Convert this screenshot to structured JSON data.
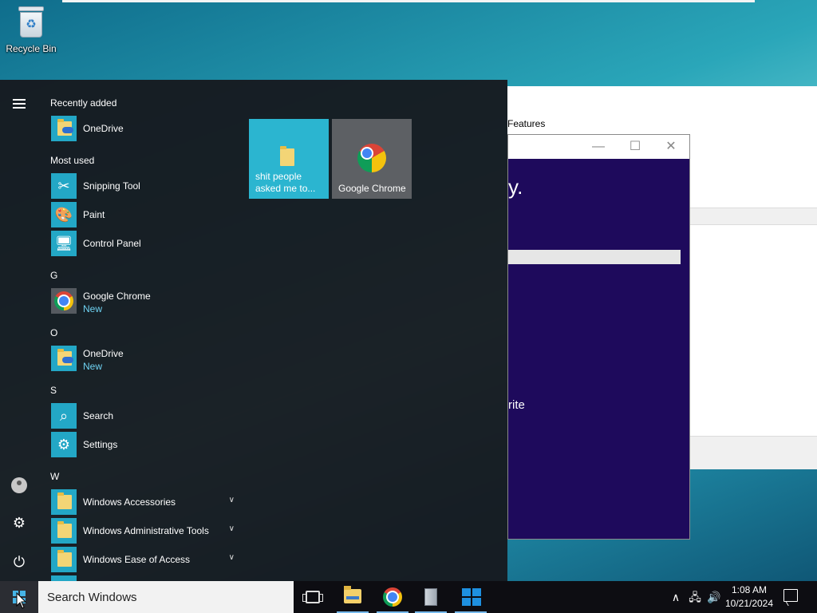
{
  "desktop": {
    "recycle_bin_label": "Recycle Bin"
  },
  "background_windows": {
    "window_a_text": "Features",
    "window_b_heading_tail": "y.",
    "window_b_body_tail": "rite",
    "window_b_controls": [
      "—",
      "☐",
      "✕"
    ]
  },
  "start_menu": {
    "recently_added_header": "Recently added",
    "recently_added": [
      {
        "name": "OneDrive",
        "icon": "onedrive-icon"
      }
    ],
    "most_used_header": "Most used",
    "most_used": [
      {
        "name": "Snipping Tool",
        "icon": "snipping-tool-icon"
      },
      {
        "name": "Paint",
        "icon": "paint-icon"
      },
      {
        "name": "Control Panel",
        "icon": "control-panel-icon"
      }
    ],
    "groups": [
      {
        "letter": "G",
        "items": [
          {
            "name": "Google Chrome",
            "badge": "New",
            "icon": "chrome-icon"
          }
        ]
      },
      {
        "letter": "O",
        "items": [
          {
            "name": "OneDrive",
            "badge": "New",
            "icon": "onedrive-icon"
          }
        ]
      },
      {
        "letter": "S",
        "items": [
          {
            "name": "Search",
            "icon": "search-icon"
          },
          {
            "name": "Settings",
            "icon": "settings-icon"
          }
        ]
      },
      {
        "letter": "W",
        "items": [
          {
            "name": "Windows Accessories",
            "icon": "folder-icon",
            "expandable": true
          },
          {
            "name": "Windows Administrative Tools",
            "icon": "folder-icon",
            "expandable": true
          },
          {
            "name": "Windows Ease of Access",
            "icon": "folder-icon",
            "expandable": true
          }
        ]
      }
    ],
    "tiles": [
      {
        "label": "shit people asked me to...",
        "icon": "folder-icon",
        "color": "#2bb5d0"
      },
      {
        "label": "Google Chrome",
        "icon": "chrome-icon",
        "color": "#5d6064"
      }
    ],
    "rail_icons": [
      "hamburger-icon",
      "user-icon",
      "settings-icon",
      "power-icon"
    ]
  },
  "taskbar": {
    "search_placeholder": "Search Windows",
    "pinned": [
      "task-view-icon",
      "file-explorer-icon",
      "chrome-icon",
      "package-icon",
      "store-icon"
    ],
    "time": "1:08 AM",
    "date": "10/21/2024",
    "accent": "#46b4e6"
  }
}
